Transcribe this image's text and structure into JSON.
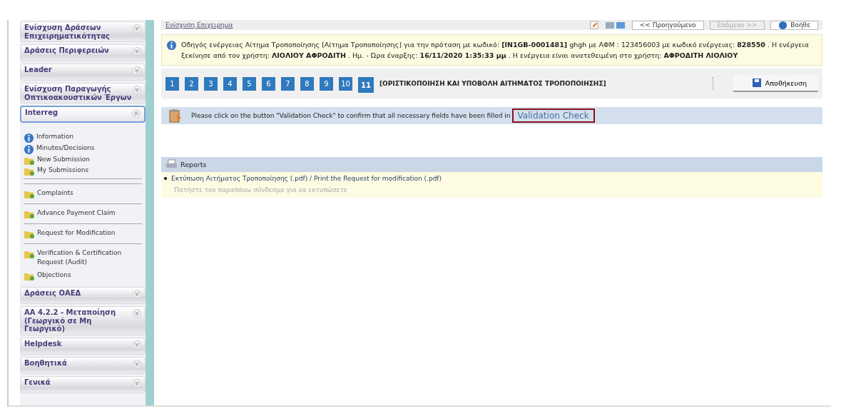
{
  "sidebar": {
    "sections": [
      {
        "title": "Ενίσχυση Δράσεων Επιχειρηματικότητας",
        "expanded": false
      },
      {
        "title": "Δράσεις Περιφερειών",
        "expanded": false
      },
      {
        "title": "Leader",
        "expanded": false
      },
      {
        "title": "Ενίσχυση Παραγωγής Οπτικοακουστικών Έργων",
        "expanded": false
      },
      {
        "title": "Interreg",
        "expanded": true,
        "items": [
          {
            "kind": "info",
            "label": "Information"
          },
          {
            "kind": "info",
            "label": "Minutes/Decisions"
          },
          {
            "kind": "folder",
            "label": "New Submission"
          },
          {
            "kind": "folder",
            "label": "My Submissions"
          },
          {
            "kind": "separator"
          },
          {
            "kind": "separator"
          },
          {
            "kind": "folder",
            "label": "Complaints"
          },
          {
            "kind": "separator"
          },
          {
            "kind": "folder",
            "label": "Advance Payment Claim"
          },
          {
            "kind": "separator"
          },
          {
            "kind": "folder",
            "label": "Request for Modification"
          },
          {
            "kind": "separator"
          },
          {
            "kind": "folder",
            "label": "Verification & Certification Request (Audit)"
          },
          {
            "kind": "folder",
            "label": "Objections"
          }
        ]
      },
      {
        "title": "Δράσεις ΟΑΕΔ",
        "expanded": false
      },
      {
        "title": "ΑΑ 4.2.2 - Μεταποίηση (Γεωργικό σε Μη Γεωργικό)",
        "expanded": false
      },
      {
        "title": "Helpdesk",
        "expanded": false
      },
      {
        "title": "Βοηθητικά",
        "expanded": false
      },
      {
        "title": "Γενικά",
        "expanded": false
      }
    ]
  },
  "toolbar": {
    "breadcrumb": "Ενίσχυση Επιχειρημα",
    "previous_button": {
      "label": "<< Προηγούμενο",
      "disabled": false
    },
    "next_button": {
      "label": "Επόμενο >>",
      "disabled": true
    },
    "help_button": "Βοήθε"
  },
  "notice": "Οδηγός ενέργειας Αίτημα Τροποποίησης [Αίτημα Τροποποίησης] για την πρόταση με κωδικό: **[IN1GB-0001481]** ghgh με ΑΦΜ : 123456003 με κωδικό ενέργειας: **828550** . Η ενέργεια ξεκίνησε από τον χρήστη: **ΛΙΟΛΙΟΥ ΑΦΡΟΔΙΤΗ** . Ημ. - Ώρα έναρξης: **16/11/2020 1:35:33 μμ** . Η ενέργεια είναι ανατεθειμένη στο χρήστη: **ΑΦΡΟΔΙΤΗ ΛΙΟΛΙΟΥ**",
  "steps": [
    {
      "label": "1",
      "selected": false
    },
    {
      "label": "2",
      "selected": false
    },
    {
      "label": "3",
      "selected": false
    },
    {
      "label": "4",
      "selected": false
    },
    {
      "label": "5",
      "selected": false
    },
    {
      "label": "6",
      "selected": false
    },
    {
      "label": "7",
      "selected": false
    },
    {
      "label": "8",
      "selected": false
    },
    {
      "label": "9",
      "selected": false
    },
    {
      "label": "10",
      "selected": false
    },
    {
      "label": "11",
      "selected": true
    }
  ],
  "step_title": "[ΟΡΙΣΤΙΚΟΠΟΙΗΣΗ ΚΑΙ ΥΠΟΒΟΛΗ ΑΙΤΗΜΑΤΟΣ ΤΡΟΠΟΠΟΙΗΣΗΣ]",
  "save_button": "Αποθήκευση",
  "validation": {
    "message": "Please click on the button \"Validation Check\" to confirm that all necessary fields have been filled in",
    "button": "Validation Check",
    "highlighted": true
  },
  "reports": {
    "title": "Reports",
    "links": [
      {
        "label": "Εκτύπωση Αιτήματος Τροποποίησης (.pdf) / Print the Request for modification (.pdf)",
        "hint": "Πατήστε τον παραπάνω σύνδεσμο για να εκτυπώσετε"
      }
    ]
  }
}
